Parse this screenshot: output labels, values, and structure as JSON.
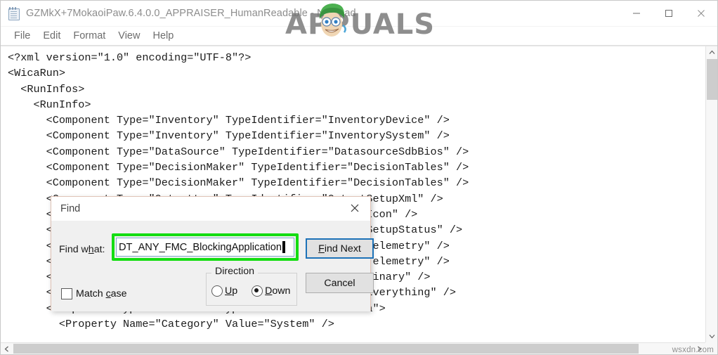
{
  "window": {
    "title": "GZMkX+7MokaoiPaw.6.4.0.0_APPRAISER_HumanReadable - Notepad",
    "icon": "notepad-icon",
    "controls": {
      "minimize": "minimize-icon",
      "maximize": "maximize-icon",
      "close": "close-icon"
    }
  },
  "menubar": {
    "items": [
      {
        "label": "File"
      },
      {
        "label": "Edit"
      },
      {
        "label": "Format"
      },
      {
        "label": "View"
      },
      {
        "label": "Help"
      }
    ]
  },
  "editor": {
    "content": "<?xml version=\"1.0\" encoding=\"UTF-8\"?>\n<WicaRun>\n  <RunInfos>\n    <RunInfo>\n      <Component Type=\"Inventory\" TypeIdentifier=\"InventoryDevice\" />\n      <Component Type=\"Inventory\" TypeIdentifier=\"InventorySystem\" />\n      <Component Type=\"DataSource\" TypeIdentifier=\"DatasourceSdbBios\" />\n      <Component Type=\"DecisionMaker\" TypeIdentifier=\"DecisionTables\" />\n      <Component Type=\"DecisionMaker\" TypeIdentifier=\"DecisionTables\" />\n      <Component Type=\"Outputter\" TypeIdentifier=\"OutputSetupXml\" />\n      <Component Type=\"Outputter\" TypeIdentifier=\"OutputIcon\" />\n      <Component Type=\"Outputter\" TypeIdentifier=\"OutputSetupStatus\" />\n      <Component Type=\"Outputter\" TypeIdentifier=\"OutputTelemetry\" />\n      <Component Type=\"Outputter\" TypeIdentifier=\"OutputTelemetry\" />\n      <Component Type=\"Outputter\" TypeIdentifier=\"OutputBinary\" />\n      <Component Type=\"Outputter\" TypeIdentifier=\"OutputEverything\" />\n      <Component Type=\"Metadata\" TypeIdentifier=\"Metadata\">\n        <Property Name=\"Category\" Value=\"System\" />",
    "scrollbars": {
      "vertical_up": "chevron-up-icon",
      "vertical_down": "chevron-down-icon",
      "horizontal_left": "chevron-left-icon",
      "horizontal_right": "chevron-right-icon"
    }
  },
  "find_dialog": {
    "title": "Find",
    "close_icon": "close-icon",
    "find_what_label": "Find what:",
    "find_what_value": "DT_ANY_FMC_BlockingApplication",
    "find_next_label": "Find Next",
    "cancel_label": "Cancel",
    "direction_group_label": "Direction",
    "direction_options": [
      {
        "label": "Up",
        "selected": false
      },
      {
        "label": "Down",
        "selected": true
      }
    ],
    "match_case_label": "Match case",
    "match_case_checked": false,
    "highlight_color": "#14dd12",
    "focus_color": "#1d72b8"
  },
  "watermarks": {
    "brand": "APPUALS",
    "site": "wsxdn.com"
  }
}
